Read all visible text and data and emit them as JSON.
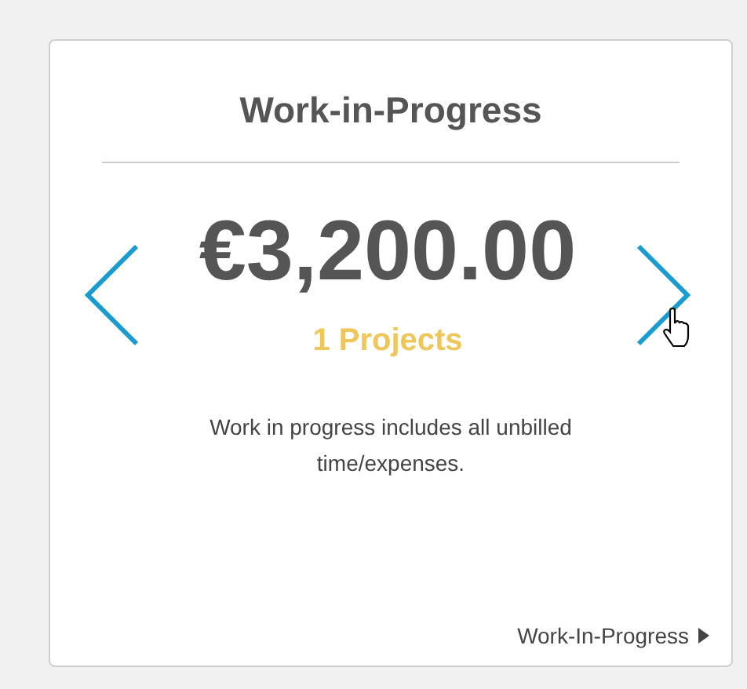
{
  "card": {
    "title": "Work-in-Progress",
    "amount": "€3,200.00",
    "projects": "1 Projects",
    "description": "Work in progress includes all unbilled time/expenses.",
    "link": "Work-In-Progress"
  }
}
